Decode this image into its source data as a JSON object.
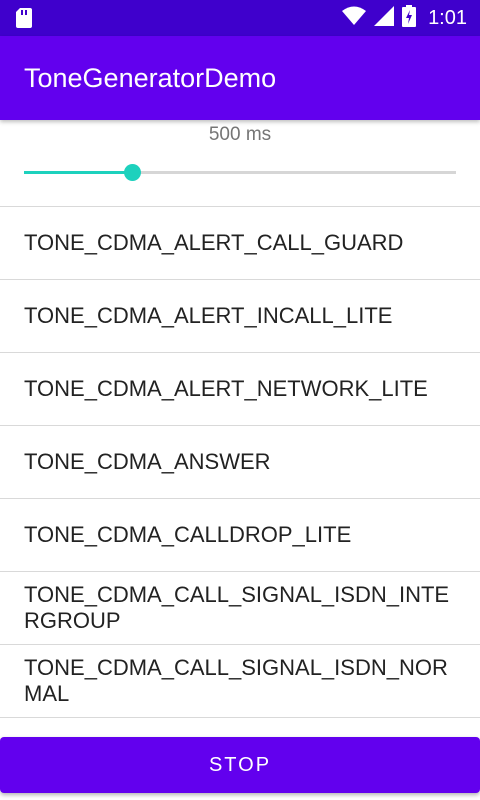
{
  "status_bar": {
    "time": "1:01",
    "icons": [
      "sd-card-icon",
      "wifi-icon",
      "signal-icon",
      "battery-icon"
    ]
  },
  "app_bar": {
    "title": "ToneGeneratorDemo"
  },
  "duration": {
    "label": "500 ms",
    "slider_value_fraction": 0.25
  },
  "tones": [
    "TONE_CDMA_ALERT_CALL_GUARD",
    "TONE_CDMA_ALERT_INCALL_LITE",
    "TONE_CDMA_ALERT_NETWORK_LITE",
    "TONE_CDMA_ANSWER",
    "TONE_CDMA_CALLDROP_LITE",
    "TONE_CDMA_CALL_SIGNAL_ISDN_INTERGROUP",
    "TONE_CDMA_CALL_SIGNAL_ISDN_NORMAL"
  ],
  "stop_button": {
    "label": "STOP"
  },
  "colors": {
    "primary": "#6200EE",
    "primary_dark": "#3F00CC",
    "accent": "#1DD1BD"
  }
}
